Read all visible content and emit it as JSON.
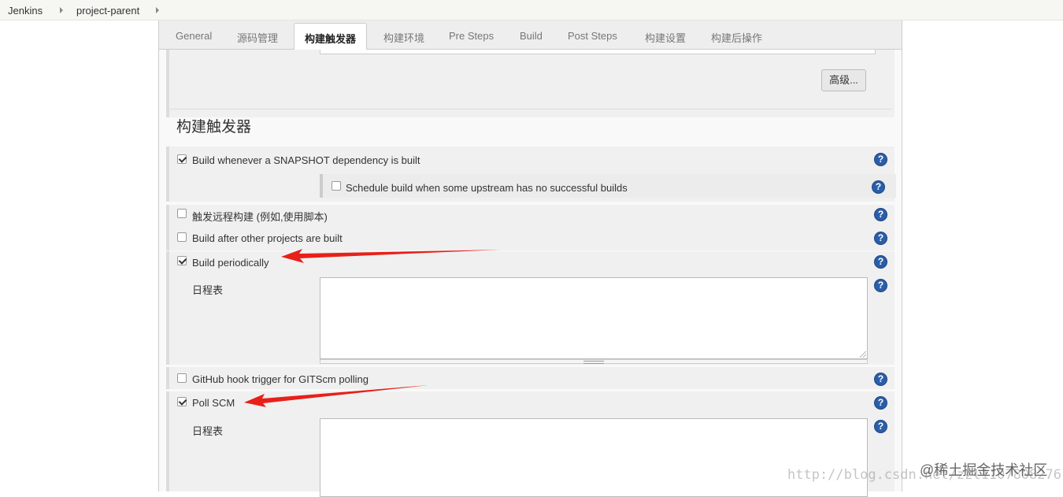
{
  "breadcrumb": [
    "Jenkins",
    "project-parent"
  ],
  "tabs": [
    "General",
    "源码管理",
    "构建触发器",
    "构建环境",
    "Pre Steps",
    "Build",
    "Post Steps",
    "构建设置",
    "构建后操作"
  ],
  "active_tab": "构建触发器",
  "advanced_button": "高级...",
  "section_title": "构建触发器",
  "triggers": {
    "snapshot": {
      "label": "Build whenever a SNAPSHOT dependency is built",
      "checked": true
    },
    "upstream": {
      "label": "Schedule build when some upstream has no successful builds",
      "checked": false
    },
    "remote": {
      "label": "触发远程构建 (例如,使用脚本)",
      "checked": false
    },
    "after_other": {
      "label": "Build after other projects are built",
      "checked": false
    },
    "periodically": {
      "label": "Build periodically",
      "checked": true
    },
    "schedule_label_1": "日程表",
    "github_hook": {
      "label": "GitHub hook trigger for GITScm polling",
      "checked": false
    },
    "poll_scm": {
      "label": "Poll SCM",
      "checked": true
    },
    "schedule_label_2": "日程表"
  },
  "help_glyph": "?",
  "watermark": {
    "juejin": "@稀土掘金技术社区",
    "csdn": "http://blog.csdn.net/zzl1107808276"
  },
  "colors": {
    "arrow": "#e8201a",
    "help": "#2b5ea8"
  }
}
